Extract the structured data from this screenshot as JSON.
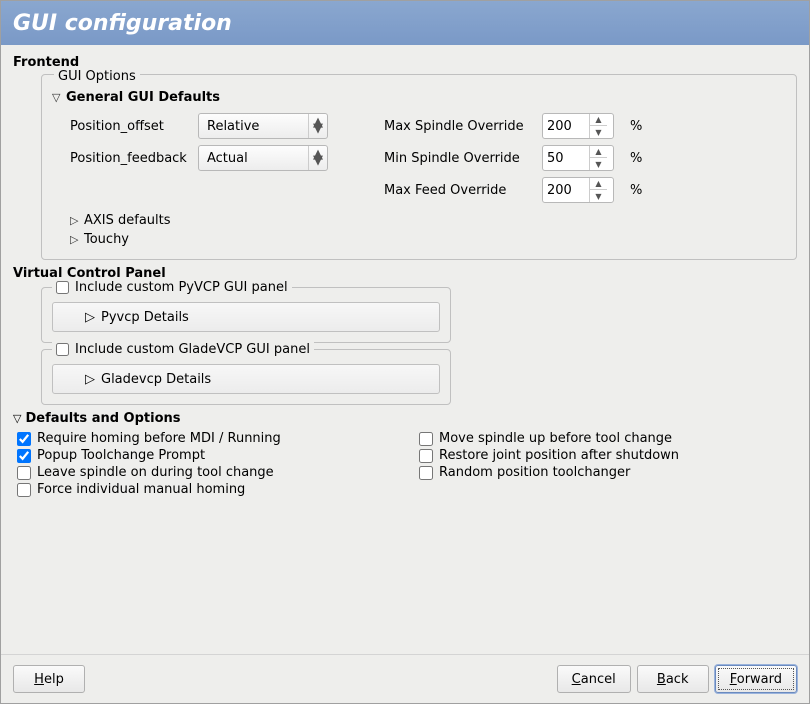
{
  "title": "GUI configuration",
  "frontend_label": "Frontend",
  "gui_options": {
    "legend": "GUI Options",
    "general_defaults": "General GUI Defaults",
    "position_offset_label": "Position_offset",
    "position_offset_value": "Relative",
    "position_feedback_label": "Position_feedback",
    "position_feedback_value": "Actual",
    "max_spindle_label": "Max Spindle Override",
    "max_spindle_value": "200",
    "min_spindle_label": "Min Spindle Override",
    "min_spindle_value": "50",
    "max_feed_label": "Max Feed Override",
    "max_feed_value": "200",
    "percent": "%",
    "axis_defaults": "AXIS defaults",
    "touchy": "Touchy"
  },
  "vcp": {
    "heading": "Virtual Control Panel",
    "pyvcp_checkbox": "Include custom PyVCP GUI panel",
    "pyvcp_details": "Pyvcp Details",
    "gladevcp_checkbox": "Include custom GladeVCP GUI panel",
    "gladevcp_details": "Gladevcp Details"
  },
  "defaults": {
    "heading": "Defaults and Options",
    "left": [
      {
        "label": "Require homing before MDI / Running",
        "checked": true
      },
      {
        "label": "Popup Toolchange Prompt",
        "checked": true
      },
      {
        "label": "Leave spindle on during tool change",
        "checked": false
      },
      {
        "label": "Force individual manual homing",
        "checked": false
      }
    ],
    "right": [
      {
        "label": "Move spindle up before tool change",
        "checked": false
      },
      {
        "label": "Restore joint position after shutdown",
        "checked": false
      },
      {
        "label": "Random position toolchanger",
        "checked": false
      }
    ]
  },
  "footer": {
    "help": "Help",
    "cancel": "Cancel",
    "back": "Back",
    "forward": "Forward"
  }
}
